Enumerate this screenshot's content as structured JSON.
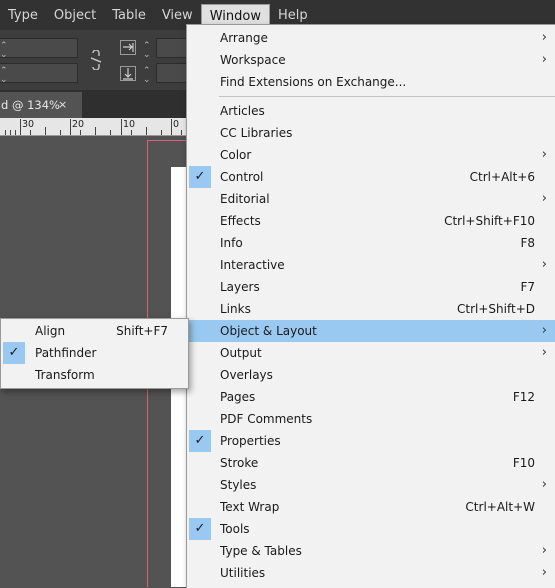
{
  "menubar": {
    "items": [
      "Type",
      "Object",
      "Table",
      "View",
      "Window",
      "Help"
    ],
    "active_index": 4
  },
  "document_tab": {
    "title": "d @ 134%",
    "close_glyph": "×"
  },
  "ruler": {
    "labels": [
      "30",
      "20",
      "10",
      "0"
    ]
  },
  "window_menu": {
    "items": [
      {
        "label": "Arrange",
        "shortcut": "",
        "submenu": true,
        "checked": false
      },
      {
        "label": "Workspace",
        "shortcut": "",
        "submenu": true,
        "checked": false
      },
      {
        "label": "Find Extensions on Exchange...",
        "shortcut": "",
        "submenu": false,
        "checked": false
      },
      {
        "label": "Articles",
        "shortcut": "",
        "submenu": false,
        "checked": false
      },
      {
        "label": "CC Libraries",
        "shortcut": "",
        "submenu": false,
        "checked": false
      },
      {
        "label": "Color",
        "shortcut": "",
        "submenu": true,
        "checked": false
      },
      {
        "label": "Control",
        "shortcut": "Ctrl+Alt+6",
        "submenu": false,
        "checked": true
      },
      {
        "label": "Editorial",
        "shortcut": "",
        "submenu": true,
        "checked": false
      },
      {
        "label": "Effects",
        "shortcut": "Ctrl+Shift+F10",
        "submenu": false,
        "checked": false
      },
      {
        "label": "Info",
        "shortcut": "F8",
        "submenu": false,
        "checked": false
      },
      {
        "label": "Interactive",
        "shortcut": "",
        "submenu": true,
        "checked": false
      },
      {
        "label": "Layers",
        "shortcut": "F7",
        "submenu": false,
        "checked": false
      },
      {
        "label": "Links",
        "shortcut": "Ctrl+Shift+D",
        "submenu": false,
        "checked": false
      },
      {
        "label": "Object & Layout",
        "shortcut": "",
        "submenu": true,
        "checked": false,
        "highlighted": true
      },
      {
        "label": "Output",
        "shortcut": "",
        "submenu": true,
        "checked": false
      },
      {
        "label": "Overlays",
        "shortcut": "",
        "submenu": false,
        "checked": false
      },
      {
        "label": "Pages",
        "shortcut": "F12",
        "submenu": false,
        "checked": false
      },
      {
        "label": "PDF Comments",
        "shortcut": "",
        "submenu": false,
        "checked": false
      },
      {
        "label": "Properties",
        "shortcut": "",
        "submenu": false,
        "checked": true
      },
      {
        "label": "Stroke",
        "shortcut": "F10",
        "submenu": false,
        "checked": false
      },
      {
        "label": "Styles",
        "shortcut": "",
        "submenu": true,
        "checked": false
      },
      {
        "label": "Text Wrap",
        "shortcut": "Ctrl+Alt+W",
        "submenu": false,
        "checked": false
      },
      {
        "label": "Tools",
        "shortcut": "",
        "submenu": false,
        "checked": true
      },
      {
        "label": "Type & Tables",
        "shortcut": "",
        "submenu": true,
        "checked": false
      },
      {
        "label": "Utilities",
        "shortcut": "",
        "submenu": true,
        "checked": false
      }
    ]
  },
  "object_layout_submenu": {
    "items": [
      {
        "label": "Align",
        "shortcut": "Shift+F7",
        "checked": false
      },
      {
        "label": "Pathfinder",
        "shortcut": "",
        "checked": true
      },
      {
        "label": "Transform",
        "shortcut": "",
        "checked": false
      }
    ]
  },
  "glyphs": {
    "submenu_arrow": "›",
    "checkmark": "✓"
  },
  "colors": {
    "highlight": "#99c9f0",
    "menu_bg": "#f2f2f2",
    "app_bg": "#535353",
    "bleed_guide": "#d9607a"
  }
}
